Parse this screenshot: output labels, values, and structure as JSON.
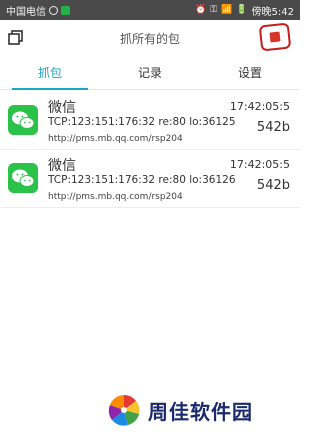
{
  "status_bar": {
    "carrier": "中国电信",
    "time": "傍晚5:42",
    "status_symbols": [
      "⏰",
      "⚿",
      "📶",
      "🔋"
    ]
  },
  "toolbar": {
    "title": "抓所有的包",
    "copy_icon": "copy-icon",
    "stop_icon": "stop-icon",
    "stop_color": "#d7352a"
  },
  "tabs": [
    {
      "label": "抓包",
      "active": true
    },
    {
      "label": "记录",
      "active": false
    },
    {
      "label": "设置",
      "active": false
    }
  ],
  "accent": "#1aa7c2",
  "packets": [
    {
      "app": "微信",
      "connection": "TCP:123:151:176:32 re:80 lo:36125",
      "url": "http://pms.mb.qq.com/rsp204",
      "time": "17:42:05:5",
      "size": "542b",
      "icon": "wechat-icon",
      "icon_color": "#2bc24a"
    },
    {
      "app": "微信",
      "connection": "TCP:123:151:176:32 re:80 lo:36126",
      "url": "http://pms.mb.qq.com/rsp204",
      "time": "17:42:05:5",
      "size": "542b",
      "icon": "wechat-icon",
      "icon_color": "#2bc24a"
    }
  ],
  "watermark": {
    "text": "周佳软件园"
  }
}
